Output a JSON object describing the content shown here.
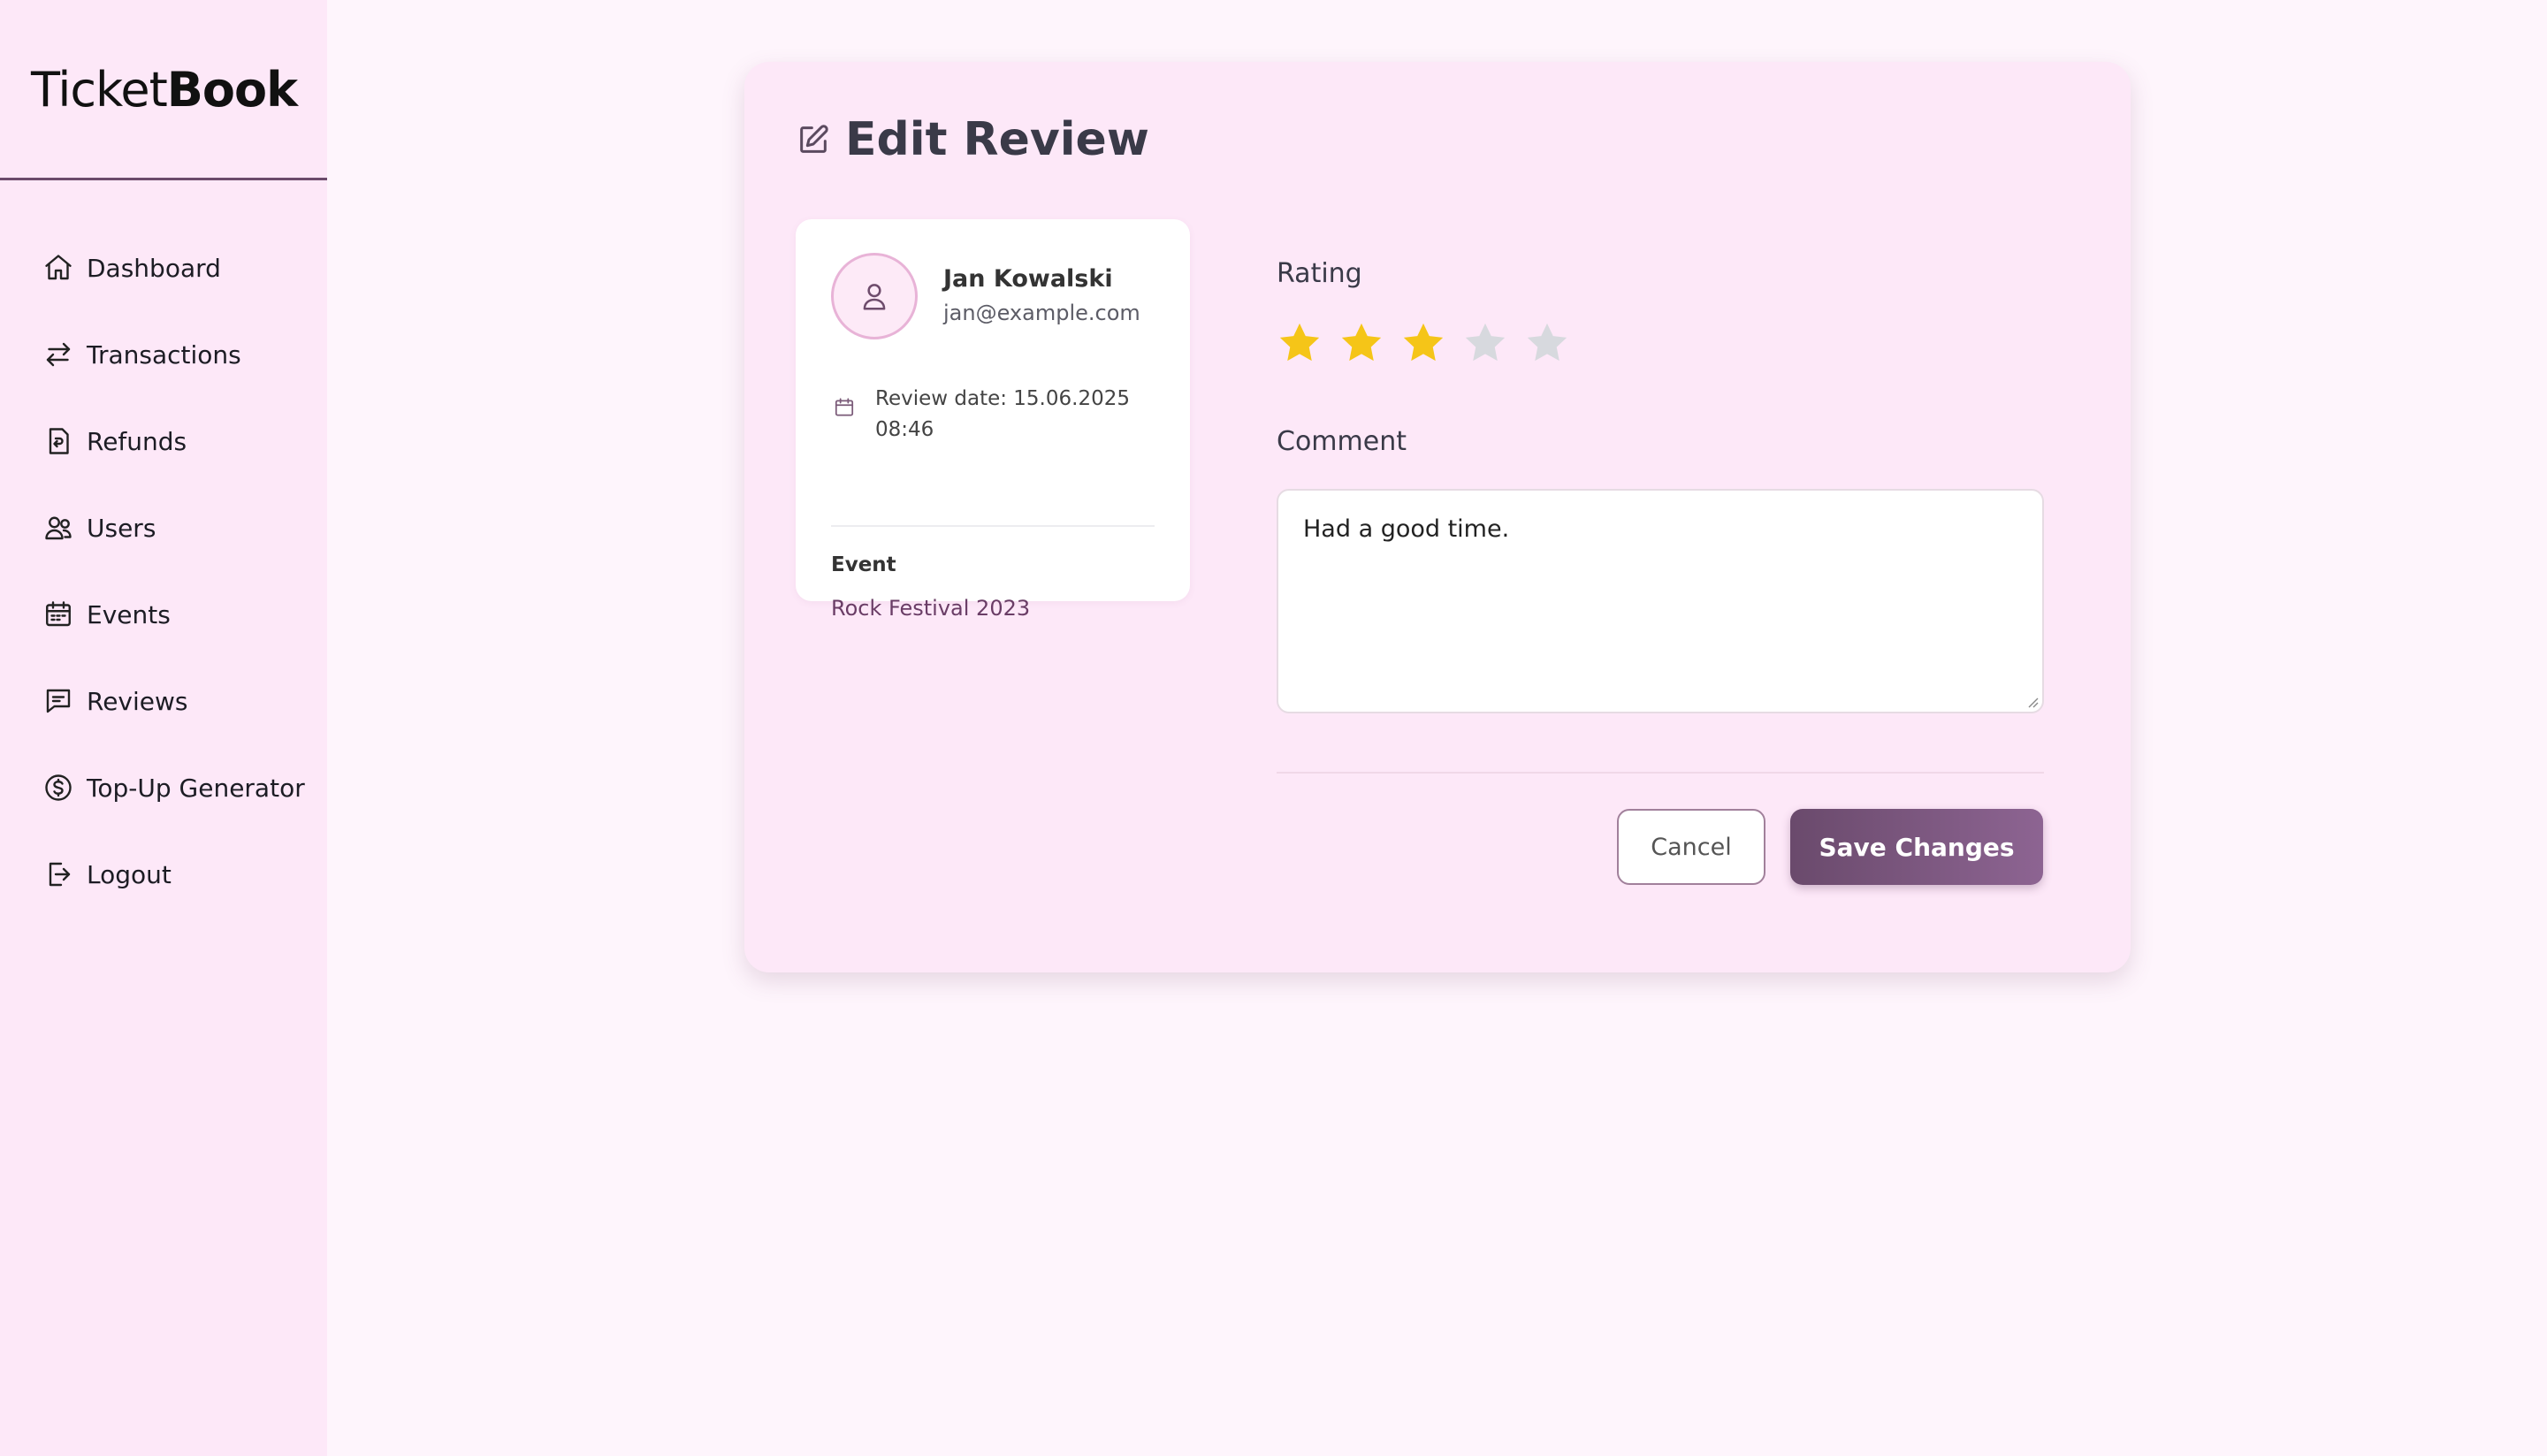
{
  "app": {
    "logo_light": "Ticket",
    "logo_bold": "Book"
  },
  "sidebar": {
    "items": [
      {
        "label": "Dashboard",
        "icon": "home-icon"
      },
      {
        "label": "Transactions",
        "icon": "arrows-exchange-icon"
      },
      {
        "label": "Refunds",
        "icon": "refund-receipt-icon"
      },
      {
        "label": "Users",
        "icon": "users-icon"
      },
      {
        "label": "Events",
        "icon": "calendar-icon"
      },
      {
        "label": "Reviews",
        "icon": "message-icon"
      },
      {
        "label": "Top-Up Generator",
        "icon": "dollar-circle-icon"
      },
      {
        "label": "Logout",
        "icon": "logout-icon"
      }
    ]
  },
  "page": {
    "title": "Edit Review",
    "title_icon": "edit-icon"
  },
  "reviewer": {
    "name": "Jan Kowalski",
    "email": "jan@example.com",
    "review_date": "Review date: 15.06.2025 08:46",
    "event_label": "Event",
    "event_name": "Rock Festival 2023"
  },
  "form": {
    "rating_label": "Rating",
    "rating_value": 3,
    "rating_max": 5,
    "comment_label": "Comment",
    "comment_value": "Had a good time.",
    "cancel_label": "Cancel",
    "save_label": "Save Changes"
  },
  "colors": {
    "accent": "#7a5479",
    "star_filled": "#f5c518",
    "star_empty": "#d7d9de",
    "sidebar_bg": "#fde8f8",
    "page_bg": "#fef5fc"
  }
}
